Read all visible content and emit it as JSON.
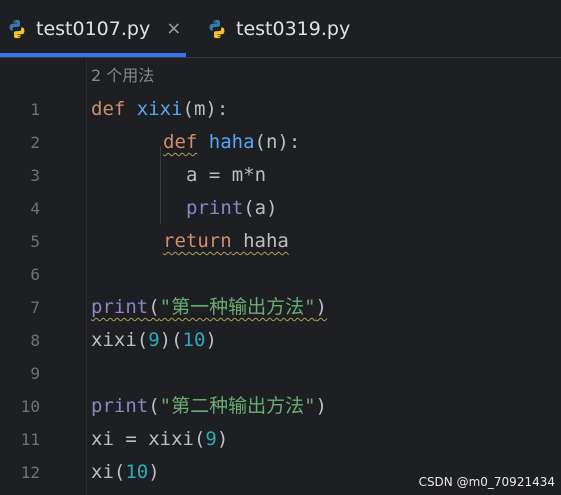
{
  "tabs": [
    {
      "label": "test0107.py",
      "active": true,
      "close": "×"
    },
    {
      "label": "test0319.py",
      "active": false
    }
  ],
  "editor": {
    "usage_hint": "2 个用法",
    "line_numbers": [
      "1",
      "2",
      "3",
      "4",
      "5",
      "6",
      "7",
      "8",
      "9",
      "10",
      "11",
      "12"
    ]
  },
  "code": {
    "l1": {
      "kw": "def",
      "name": "xixi",
      "rest": "(m):"
    },
    "l2": {
      "kw": "def",
      "name": "haha",
      "rest": "(n):"
    },
    "l3": {
      "text": "a = m*n"
    },
    "l4": {
      "fn": "print",
      "rest": "(a)"
    },
    "l5": {
      "kw": "return",
      "rest": " haha"
    },
    "l7": {
      "fn": "print",
      "open": "(",
      "str": "\"第一种输出方法\"",
      "close": ")"
    },
    "l8": {
      "a": "xixi(",
      "n1": "9",
      "b": ")(",
      "n2": "10",
      "c": ")"
    },
    "l10": {
      "fn": "print",
      "open": "(",
      "str": "\"第二种输出方法\"",
      "close": ")"
    },
    "l11": {
      "a": "xi = xixi(",
      "n1": "9",
      "c": ")"
    },
    "l12": {
      "a": "xi(",
      "n1": "10",
      "c": ")"
    }
  },
  "watermark": "CSDN @m0_70921434",
  "colors": {
    "accent": "#3574f0",
    "keyword": "#cf8e6d",
    "function": "#56a8f5",
    "string": "#6aab73",
    "number": "#2aacb8",
    "builtin": "#8888c6"
  },
  "icons": {
    "file_icon": "python-icon"
  }
}
